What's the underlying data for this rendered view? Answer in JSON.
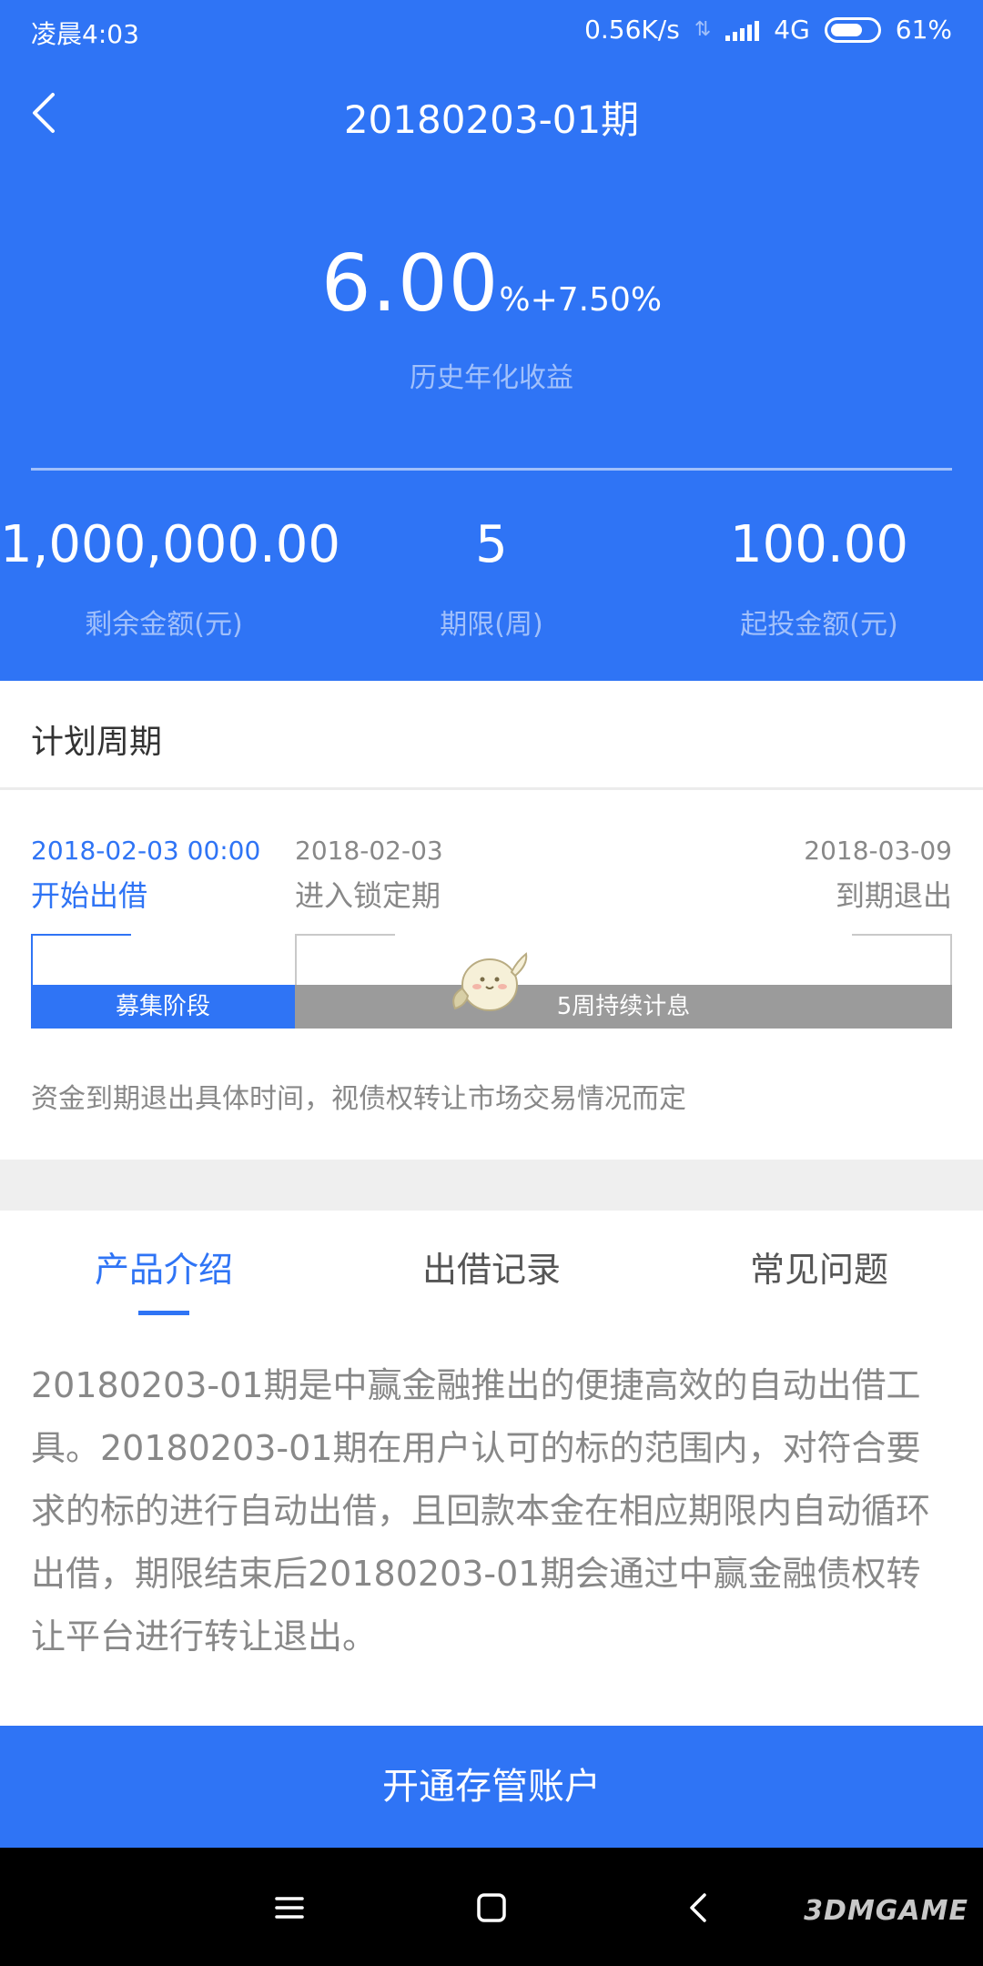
{
  "status_bar": {
    "time": "凌晨4:03",
    "speed": "0.56K/s",
    "network": "4G",
    "battery": "61%"
  },
  "header": {
    "title": "20180203-01期"
  },
  "rate": {
    "main": "6.00",
    "extra": "%+7.50%",
    "label": "历史年化收益"
  },
  "stats": [
    {
      "value": "1,000,000.00",
      "label": "剩余金额(元)"
    },
    {
      "value": "5",
      "label": "期限(周)"
    },
    {
      "value": "100.00",
      "label": "起投金额(元)"
    }
  ],
  "plan": {
    "title": "计划周期",
    "milestones": [
      {
        "date": "2018-02-03 00:00",
        "name": "开始出借"
      },
      {
        "date": "2018-02-03",
        "name": "进入锁定期"
      },
      {
        "date": "2018-03-09",
        "name": "到期退出"
      }
    ],
    "phase_raise": "募集阶段",
    "phase_interest": "5周持续计息",
    "note": "资金到期退出具体时间，视债权转让市场交易情况而定"
  },
  "tabs": [
    "产品介绍",
    "出借记录",
    "常见问题"
  ],
  "intro": "20180203-01期是中赢金融推出的便捷高效的自动出借工具。20180203-01期在用户认可的标的范围内，对符合要求的标的进行自动出借，且回款本金在相应期限内自动循环出借，期限结束后20180203-01期会通过中赢金融债权转让平台进行转让退出。",
  "cta": "开通存管账户",
  "watermark": "3DMGAME",
  "colors": {
    "accent": "#2f74f5",
    "phase_gray": "#9b9b9b",
    "muted_text": "#888888"
  },
  "icons": [
    "back-arrow-icon",
    "signal-icon",
    "battery-icon",
    "menu-icon",
    "home-icon",
    "back-nav-icon"
  ]
}
